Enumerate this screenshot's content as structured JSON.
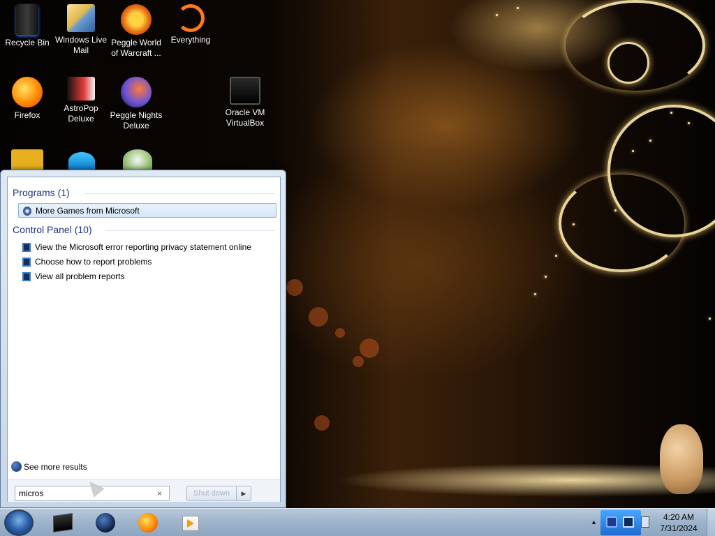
{
  "desktop": {
    "icons": [
      {
        "label": "Recycle Bin",
        "icon": "recycle-bin-icon"
      },
      {
        "label": "Windows Live Mail",
        "icon": "mail-icon"
      },
      {
        "label": "Peggle World of Warcraft ...",
        "icon": "peggle-wow-icon"
      },
      {
        "label": "Everything",
        "icon": "everything-icon"
      },
      {
        "label": "Firefox",
        "icon": "firefox-icon"
      },
      {
        "label": "AstroPop Deluxe",
        "icon": "astropop-icon"
      },
      {
        "label": "Peggle Nights Deluxe",
        "icon": "peggle-nights-icon"
      },
      {
        "label": "Oracle VM VirtualBox",
        "icon": "virtualbox-icon"
      }
    ]
  },
  "start_menu": {
    "groups": [
      {
        "header": "Programs (1)",
        "items": [
          {
            "label": "More Games from Microsoft",
            "selected": true
          }
        ]
      },
      {
        "header": "Control Panel (10)",
        "items": [
          {
            "label": "View the Microsoft error reporting privacy statement online"
          },
          {
            "label": "Choose how to report problems"
          },
          {
            "label": "View all problem reports"
          }
        ]
      }
    ],
    "see_more": "See more results",
    "search": {
      "value": "micros",
      "clear": "×"
    },
    "shutdown_label": "Shut down",
    "shutdown_arrow": "▶"
  },
  "taskbar": {
    "pinned": [
      "virtualbox-icon",
      "globe-icon",
      "firefox-icon",
      "media-player-icon"
    ],
    "tray": {
      "overflow": "▲",
      "time": "4:20 AM",
      "date": "7/31/2024"
    }
  },
  "colors": {
    "accent": "#1e3287",
    "taskbar": "#9db3cb",
    "selection": "#d5e6f8"
  }
}
